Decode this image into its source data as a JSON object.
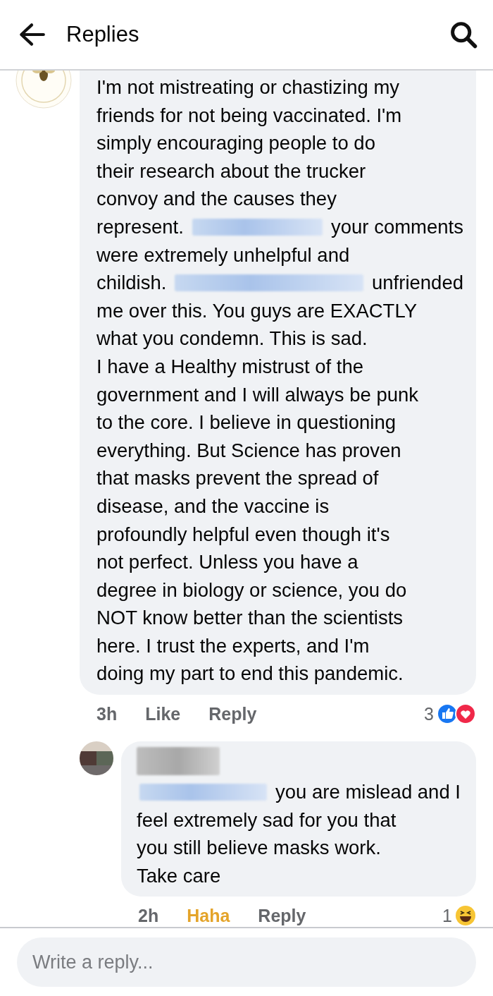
{
  "header": {
    "title": "Replies"
  },
  "comments": [
    {
      "avatar": {
        "kind": "logo"
      },
      "lines": [
        [
          {
            "kind": "text",
            "text": "I'm not mistreating or chastizing my"
          }
        ],
        [
          {
            "kind": "text",
            "text": "friends for not being vaccinated.  I'm"
          }
        ],
        [
          {
            "kind": "text",
            "text": "simply encouraging people to do"
          }
        ],
        [
          {
            "kind": "text",
            "text": "their research about the trucker"
          }
        ],
        [
          {
            "kind": "text",
            "text": "convoy and the causes they"
          }
        ],
        [
          {
            "kind": "text",
            "text": "represent."
          },
          {
            "kind": "redacted"
          },
          {
            "kind": "text",
            "text": "your comments"
          }
        ],
        [
          {
            "kind": "text",
            "text": "were extremely unhelpful and"
          }
        ],
        [
          {
            "kind": "text",
            "text": "childish."
          },
          {
            "kind": "redacted"
          },
          {
            "kind": "text",
            "text": "unfriended"
          }
        ],
        [
          {
            "kind": "text",
            "text": "me over this.  You guys are EXACTLY"
          }
        ],
        [
          {
            "kind": "text",
            "text": "what you condemn.  This is sad."
          }
        ],
        [
          {
            "kind": "text",
            "text": "I have a Healthy mistrust of the"
          }
        ],
        [
          {
            "kind": "text",
            "text": "government and I will always be punk"
          }
        ],
        [
          {
            "kind": "text",
            "text": "to the core.  I believe in questioning"
          }
        ],
        [
          {
            "kind": "text",
            "text": "everything.  But Science has proven"
          }
        ],
        [
          {
            "kind": "text",
            "text": "that masks prevent the spread of"
          }
        ],
        [
          {
            "kind": "text",
            "text": "disease, and the vaccine is"
          }
        ],
        [
          {
            "kind": "text",
            "text": "profoundly helpful even though it's"
          }
        ],
        [
          {
            "kind": "text",
            "text": "not perfect.  Unless you have a"
          }
        ],
        [
          {
            "kind": "text",
            "text": "degree in biology or science, you do"
          }
        ],
        [
          {
            "kind": "text",
            "text": "NOT know better than the scientists"
          }
        ],
        [
          {
            "kind": "text",
            "text": "here.  I trust the experts, and I'm"
          }
        ],
        [
          {
            "kind": "text",
            "text": "doing my part to end this pandemic."
          }
        ]
      ],
      "time": "3h",
      "reaction_action": {
        "label": "Like",
        "selected": false
      },
      "reply": "Reply",
      "count": "3",
      "reactions": [
        {
          "kind": "like"
        },
        {
          "kind": "love"
        }
      ]
    },
    {
      "avatar": {
        "kind": "photo"
      },
      "author_redacted": true,
      "lines": [
        [
          {
            "kind": "redacted"
          },
          {
            "kind": "text",
            "text": "you are mislead and I"
          }
        ],
        [
          {
            "kind": "text",
            "text": "feel extremely sad for you that"
          }
        ],
        [
          {
            "kind": "text",
            "text": "you still believe masks work."
          }
        ],
        [
          {
            "kind": "text",
            "text": "Take care"
          }
        ]
      ],
      "time": "2h",
      "reaction_action": {
        "label": "Haha",
        "selected": true
      },
      "reply": "Reply",
      "count": "1",
      "reactions": [
        {
          "kind": "haha"
        }
      ]
    }
  ],
  "composer": {
    "placeholder": "Write a reply..."
  }
}
